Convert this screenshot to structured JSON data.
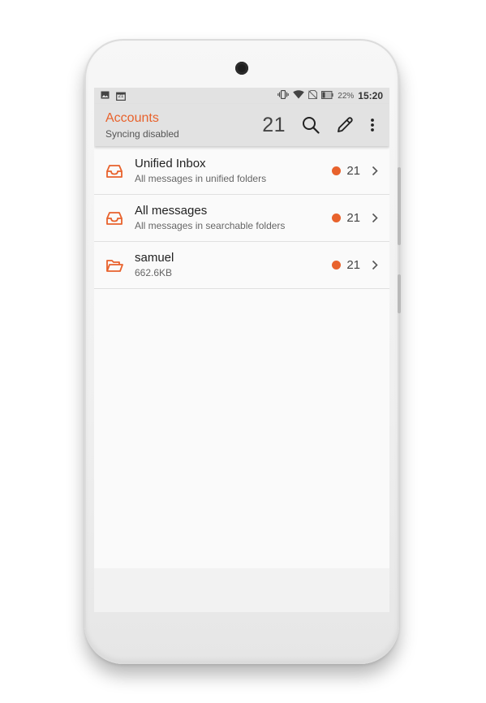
{
  "status_bar": {
    "battery_text": "22%",
    "time": "15:20",
    "left_icons": [
      "image-icon",
      "calendar-icon"
    ],
    "right_icons": [
      "vibrate-icon",
      "wifi-icon",
      "no-sim-icon",
      "battery-icon"
    ],
    "calendar_day": "21"
  },
  "toolbar": {
    "title": "Accounts",
    "subtitle": "Syncing disabled",
    "unread_total": "21",
    "actions": [
      "search-icon",
      "compose-icon",
      "more-vert-icon"
    ]
  },
  "accounts": [
    {
      "title": "Unified Inbox",
      "subtitle": "All messages in unified folders",
      "count": "21",
      "icon": "inbox-icon"
    },
    {
      "title": "All messages",
      "subtitle": "All messages in searchable folders",
      "count": "21",
      "icon": "inbox-icon"
    },
    {
      "title": "samuel",
      "subtitle": "662.6KB",
      "count": "21",
      "icon": "folder-open-icon"
    }
  ],
  "colors": {
    "accent": "#e8622c",
    "toolbar_bg": "#e2e2e2",
    "screen_bg": "#fafafa"
  }
}
